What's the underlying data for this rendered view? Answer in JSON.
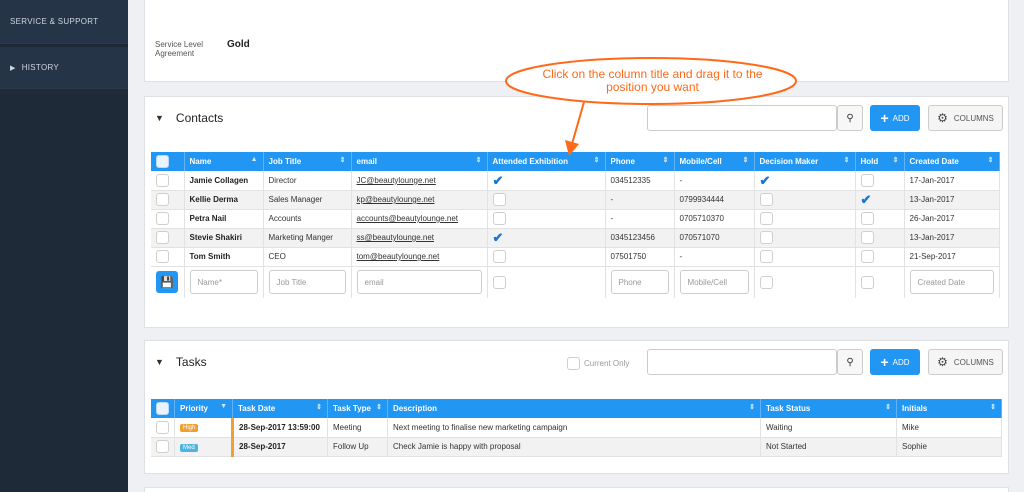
{
  "sidebar": {
    "items": [
      {
        "label": "SERVICE & SUPPORT"
      },
      {
        "label": "HISTORY"
      }
    ]
  },
  "sla": {
    "label": "Service Level Agreement",
    "value": "Gold"
  },
  "callout": {
    "text": "Click on the column title and drag it to the position you want"
  },
  "contacts": {
    "title": "Contacts",
    "search_placeholder": "",
    "add_label": "ADD",
    "columns_label": "COLUMNS",
    "headers": [
      "Name",
      "Job Title",
      "email",
      "Attended Exhibition",
      "Phone",
      "Mobile/Cell",
      "Decision Maker",
      "Hold",
      "Created Date"
    ],
    "rows": [
      {
        "name": "Jamie Collagen",
        "job": "Director",
        "email": "JC@beautylounge.net",
        "attended": true,
        "phone": "034512335",
        "mobile": "-",
        "decision": true,
        "hold": false,
        "created": "17-Jan-2017"
      },
      {
        "name": "Kellie Derma",
        "job": "Sales Manager",
        "email": "kp@beautylounge.net",
        "attended": false,
        "phone": "-",
        "mobile": "0799934444",
        "decision": false,
        "hold": true,
        "created": "13-Jan-2017"
      },
      {
        "name": "Petra Nail",
        "job": "Accounts",
        "email": "accounts@beautylounge.net",
        "attended": false,
        "phone": "-",
        "mobile": "0705710370",
        "decision": false,
        "hold": false,
        "created": "26-Jan-2017"
      },
      {
        "name": "Stevie Shakiri",
        "job": "Marketing Manger",
        "email": "ss@beautylounge.net",
        "attended": true,
        "phone": "0345123456",
        "mobile": "070571070",
        "decision": false,
        "hold": false,
        "created": "13-Jan-2017"
      },
      {
        "name": "Tom Smith",
        "job": "CEO",
        "email": "tom@beautylounge.net",
        "attended": false,
        "phone": "07501750",
        "mobile": "-",
        "decision": false,
        "hold": false,
        "created": "21-Sep-2017"
      }
    ],
    "new_row": {
      "name": "Name*",
      "job": "Job Title",
      "email": "email",
      "phone": "Phone",
      "mobile": "Mobile/Cell",
      "created": "Created Date"
    }
  },
  "tasks": {
    "title": "Tasks",
    "current_only_label": "Current Only",
    "add_label": "ADD",
    "columns_label": "COLUMNS",
    "headers": [
      "Priority",
      "Task Date",
      "Task Type",
      "Description",
      "Task Status",
      "Initials"
    ],
    "rows": [
      {
        "priority": "High",
        "date": "28-Sep-2017 13:59:00",
        "type": "Meeting",
        "description": "Next meeting to finalise new marketing campaign",
        "status": "Waiting",
        "initials": "Mike"
      },
      {
        "priority": "Med",
        "date": "28-Sep-2017",
        "type": "Follow Up",
        "description": "Check Jamie is happy with proposal",
        "status": "Not Started",
        "initials": "Sophie"
      }
    ]
  }
}
